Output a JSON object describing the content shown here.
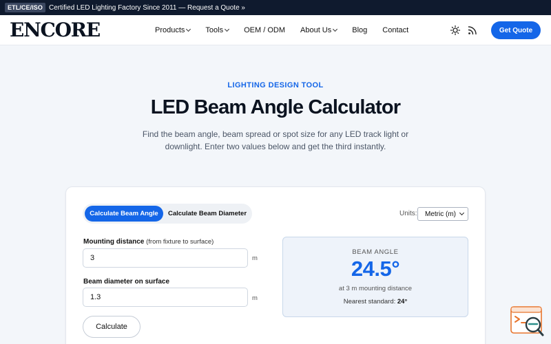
{
  "topbar": {
    "badge": "ETL/CE/ISO",
    "text": "Certified LED Lighting Factory Since 2011 — Request a Quote »"
  },
  "header": {
    "logo": "ENCORE",
    "nav": [
      {
        "label": "Products",
        "has_dropdown": true
      },
      {
        "label": "Tools",
        "has_dropdown": true
      },
      {
        "label": "OEM / ODM",
        "has_dropdown": false
      },
      {
        "label": "About Us",
        "has_dropdown": true
      },
      {
        "label": "Blog",
        "has_dropdown": false
      },
      {
        "label": "Contact",
        "has_dropdown": false
      }
    ],
    "icons": [
      "sun-icon",
      "rss-icon"
    ],
    "cta_label": "Get Quote"
  },
  "hero": {
    "kicker": "LIGHTING DESIGN TOOL",
    "title": "LED Beam Angle Calculator",
    "subtitle": "Find the beam angle, beam spread or spot size for any LED track light or downlight. Enter two values below and get the third instantly."
  },
  "calculator": {
    "modes": [
      {
        "label": "Calculate Beam Angle",
        "active": true
      },
      {
        "label": "Calculate Beam Diameter",
        "active": false
      }
    ],
    "units_label": "Units:",
    "units_value": "Metric (m)",
    "fields": [
      {
        "label": "Mounting distance",
        "hint": "(from fixture to surface)",
        "value": "3",
        "unit": "m"
      },
      {
        "label": "Beam diameter on surface",
        "hint": "",
        "value": "1.3",
        "unit": "m"
      }
    ],
    "button_label": "Calculate",
    "result": {
      "label": "BEAM ANGLE",
      "value": "24.5°",
      "note": "at 3 m mounting distance",
      "standard_label": "Nearest standard:",
      "standard_value": "24°"
    }
  },
  "colors": {
    "accent": "#1466e8",
    "topbar": "#0f1a2e",
    "background": "#f3f6fa",
    "widget": "#e8742c"
  }
}
